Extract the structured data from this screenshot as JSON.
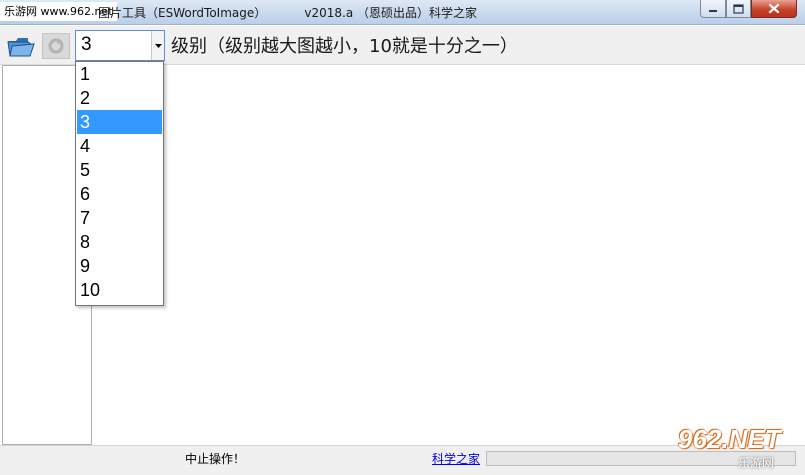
{
  "watermark": {
    "top_left": "乐游网 www.962.net",
    "bottom_right_main": "962.NET",
    "bottom_right_sub": "乐游网"
  },
  "window": {
    "title": "图片工具（ESWordToImage）          v2018.a （恩硕出品）科学之家"
  },
  "toolbar": {
    "level_value": "3",
    "level_label": "级别（级别越大图越小，10就是十分之一）"
  },
  "dropdown": {
    "options": [
      "1",
      "2",
      "3",
      "4",
      "5",
      "6",
      "7",
      "8",
      "9",
      "10"
    ],
    "selected": "3"
  },
  "status": {
    "text": "中止操作！",
    "link": "科学之家",
    "progress": 0
  }
}
